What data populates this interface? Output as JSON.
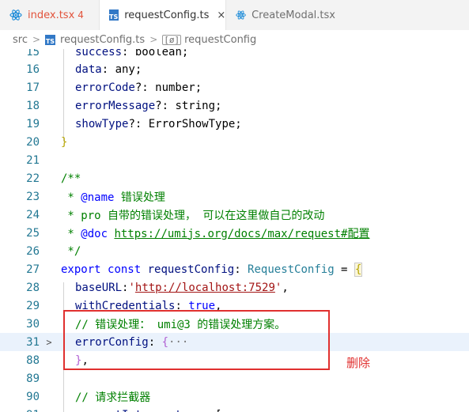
{
  "tabs": [
    {
      "label": "index.tsx",
      "count": "4",
      "icon": "react-icon"
    },
    {
      "label": "requestConfig.ts",
      "close": "×",
      "icon": "ts-icon"
    },
    {
      "label": "CreateModal.tsx",
      "icon": "react-icon"
    }
  ],
  "breadcrumb": {
    "folder": "src",
    "file": "requestConfig.ts",
    "symbol": "requestConfig",
    "separator": ">"
  },
  "lines": [
    {
      "n": "15",
      "text": "success: boolean;"
    },
    {
      "n": "16",
      "text": "data: any;"
    },
    {
      "n": "17",
      "text": "errorCode?: number;"
    },
    {
      "n": "18",
      "text": "errorMessage?: string;"
    },
    {
      "n": "19",
      "text": "showType?: ErrorShowType;"
    },
    {
      "n": "20",
      "text": "}"
    },
    {
      "n": "21",
      "text": ""
    },
    {
      "n": "22",
      "text": "/**"
    },
    {
      "n": "23",
      "text": " * @name 错误处理"
    },
    {
      "n": "24",
      "text": " * pro 自带的错误处理， 可以在这里做自己的改动"
    },
    {
      "n": "25",
      "text": " * @doc https://umijs.org/docs/max/request#配置"
    },
    {
      "n": "26",
      "text": " */"
    },
    {
      "n": "27",
      "text": "export const requestConfig: RequestConfig = {"
    },
    {
      "n": "28",
      "text": "baseURL:'http://localhost:7529',"
    },
    {
      "n": "29",
      "text": "withCredentials: true,"
    },
    {
      "n": "30",
      "text": "// 错误处理： umi@3 的错误处理方案。"
    },
    {
      "n": "31",
      "text": "errorConfig: {···"
    },
    {
      "n": "88",
      "text": "},"
    },
    {
      "n": "89",
      "text": ""
    },
    {
      "n": "90",
      "text": "// 请求拦截器"
    },
    {
      "n": "91",
      "text": "requestInterceptors: ["
    }
  ],
  "tokens": {
    "l15a": "success",
    "l15b": ": boolean;",
    "l16a": "data",
    "l16b": ": any;",
    "l17a": "errorCode",
    "l17b": "?: number;",
    "l18a": "errorMessage",
    "l18b": "?: string;",
    "l19a": "showType",
    "l19b": "?: ErrorShowType;",
    "l20": "}",
    "l22": "/**",
    "l23a": " * ",
    "l23b": "@name",
    "l23c": " 错误处理",
    "l24": " * pro 自带的错误处理， 可以在这里做自己的改动",
    "l25a": " * ",
    "l25b": "@doc",
    "l25c": " ",
    "l25d": "https://umijs.org/docs/max/request#配置",
    "l26": " */",
    "l27a": "export",
    "l27b": " ",
    "l27c": "const",
    "l27d": " ",
    "l27e": "requestConfig",
    "l27f": ": ",
    "l27g": "RequestConfig",
    "l27h": " = ",
    "l27i": "{",
    "l28a": "baseURL",
    "l28b": ":",
    "l28c": "'",
    "l28d": "http://localhost:7529",
    "l28e": "'",
    "l28f": ",",
    "l29a": "withCredentials",
    "l29b": ": ",
    "l29c": "true",
    "l29d": ",",
    "l30": "// 错误处理： umi@3 的错误处理方案。",
    "l31a": "errorConfig",
    "l31b": ": ",
    "l31c": "{",
    "l31d": "···",
    "l88a": "}",
    "l88b": ",",
    "l90": "// 请求拦截器",
    "l91a": "requestInterceptors",
    "l91b": ": ["
  },
  "fold_chevron": ">",
  "annotation": {
    "label": "删除",
    "color": "#e0302f"
  },
  "colors": {
    "keyword": "#0000ff",
    "type": "#267f99",
    "variable": "#001080",
    "string": "#a31515",
    "comment": "#008000",
    "line_number": "#237893"
  }
}
